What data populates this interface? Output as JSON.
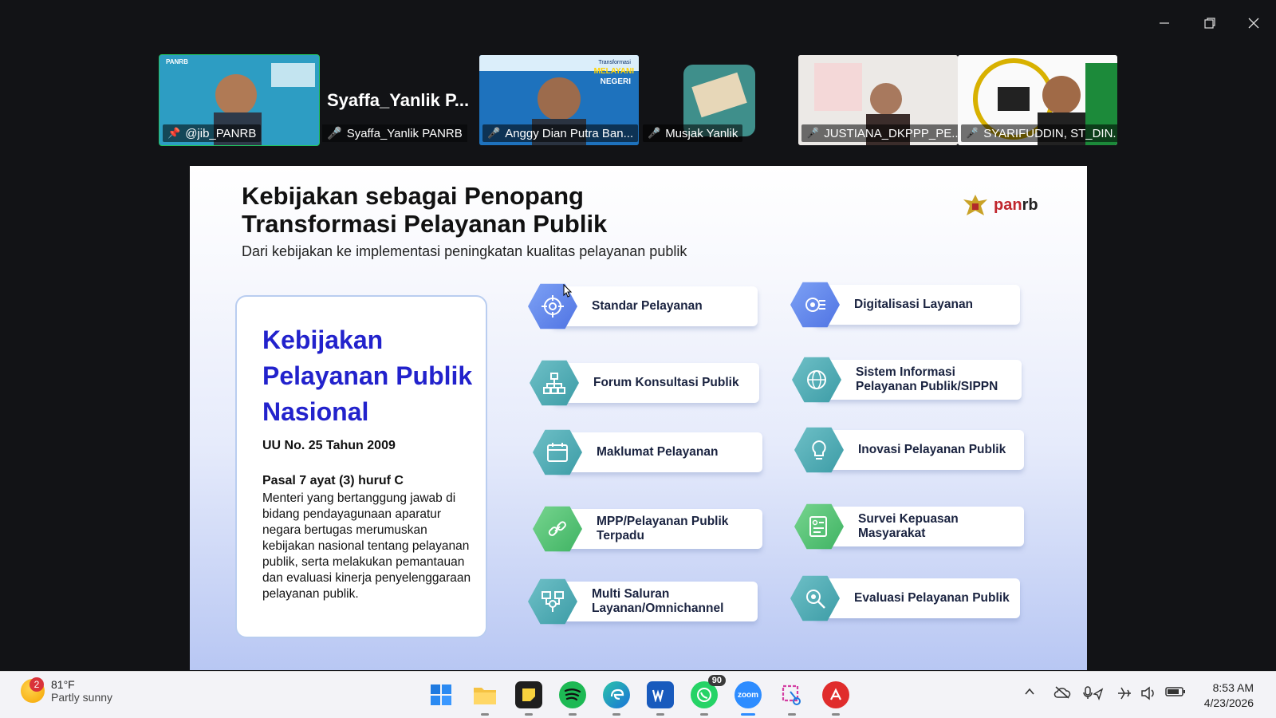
{
  "window_controls": {
    "minimize": "minimize-icon",
    "restore": "restore-icon",
    "close": "close-icon"
  },
  "participants": [
    {
      "name": "@jib_PANRB",
      "active": true,
      "pinned": true
    },
    {
      "name": "Syaffa_Yanlik PANRB",
      "display_name": "Syaffa_Yanlik P...",
      "video": false
    },
    {
      "name": "Anggy Dian Putra Ban..."
    },
    {
      "name": "Musjak Yanlik"
    },
    {
      "name": "JUSTIANA_DKPPP_PE..."
    },
    {
      "name": "SYARIFUDDIN, ST_DIN..."
    }
  ],
  "tile_overlays": {
    "t1": "PANRB",
    "t3a": "Transformasi",
    "t3b": "MELAYANI",
    "t3c": "NEGERI"
  },
  "slide": {
    "title_line1": "Kebijakan sebagai Penopang",
    "title_line2": "Transformasi Pelayanan Publik",
    "subtitle": "Dari kebijakan ke implementasi peningkatan kualitas pelayanan publik",
    "logo": {
      "text_a": "pan",
      "text_b": "rb"
    },
    "policy_card": {
      "title": "Kebijakan Pelayanan Publik Nasional",
      "law": "UU No. 25 Tahun 2009",
      "article": "Pasal 7 ayat (3) huruf C",
      "body": "Menteri yang bertanggung jawab di bidang pendayagunaan aparatur negara bertugas merumuskan kebijakan nasional tentang pelayanan publik, serta melakukan pemantauan dan evaluasi kinerja penyelenggaraan pelayanan publik."
    },
    "left_items": [
      {
        "label": "Standar Pelayanan",
        "icon": "target-icon",
        "color": "blue"
      },
      {
        "label": "Forum Konsultasi Publik",
        "icon": "hierarchy-icon",
        "color": "teal"
      },
      {
        "label": "Maklumat Pelayanan",
        "icon": "calendar-icon",
        "color": "teal"
      },
      {
        "label": "MPP/Pelayanan Publik Terpadu",
        "icon": "link-icon",
        "color": "green"
      },
      {
        "label": "Multi Saluran Layanan/Omnichannel",
        "icon": "channels-icon",
        "color": "teal"
      }
    ],
    "right_items": [
      {
        "label": "Digitalisasi Layanan",
        "icon": "digital-gear-icon",
        "color": "blue"
      },
      {
        "label": "Sistem Informasi Pelayanan Publik/SIPPN",
        "icon": "globe-icon",
        "color": "teal"
      },
      {
        "label": "Inovasi Pelayanan Publik",
        "icon": "lightbulb-icon",
        "color": "teal"
      },
      {
        "label": "Survei Kepuasan Masyarakat",
        "icon": "survey-icon",
        "color": "green"
      },
      {
        "label": "Evaluasi Pelayanan Publik",
        "icon": "magnifier-gear-icon",
        "color": "teal"
      }
    ]
  },
  "taskbar": {
    "weather": {
      "temp": "81°F",
      "condition": "Partly sunny",
      "badge": "2"
    },
    "apps": [
      "start-icon",
      "file-explorer-icon",
      "sticky-notes-icon",
      "spotify-icon",
      "edge-icon",
      "word-icon",
      "whatsapp-icon",
      "zoom-icon",
      "snipping-tool-icon",
      "acrobat-icon"
    ],
    "whatsapp_badge": "90",
    "zoom_label": "zoom",
    "time": "8:53 AM",
    "date": "4/23/2026"
  }
}
